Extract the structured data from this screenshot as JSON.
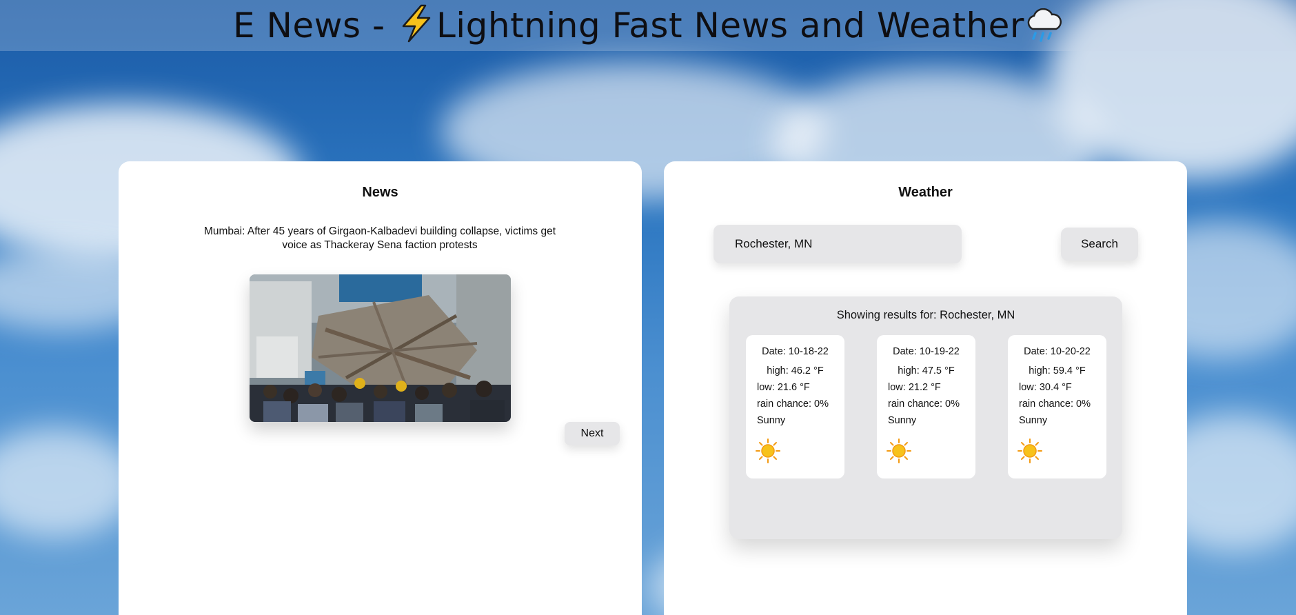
{
  "header": {
    "title_prefix": "E News - ",
    "title_main": "Lightning Fast News and Weather",
    "lightning_icon": "lightning-icon",
    "rain_cloud_icon": "rain-cloud-icon"
  },
  "news": {
    "heading": "News",
    "headline": "Mumbai: After 45 years of Girgaon-Kalbadevi building collapse, victims get voice as Thackeray Sena faction protests",
    "next_label": "Next"
  },
  "weather": {
    "heading": "Weather",
    "search_value": "Rochester, MN",
    "search_label": "Search",
    "results_heading": "Showing results for: Rochester, MN",
    "days": [
      {
        "date": "Date: 10-18-22",
        "high": "high: 46.2 °F",
        "low": "low: 21.6 °F",
        "rain": "rain chance: 0%",
        "condition": "Sunny",
        "icon": "sun-icon"
      },
      {
        "date": "Date: 10-19-22",
        "high": "high: 47.5 °F",
        "low": "low: 21.2 °F",
        "rain": "rain chance: 0%",
        "condition": "Sunny",
        "icon": "sun-icon"
      },
      {
        "date": "Date: 10-20-22",
        "high": "high: 59.4 °F",
        "low": "low: 30.4 °F",
        "rain": "rain chance: 0%",
        "condition": "Sunny",
        "icon": "sun-icon"
      }
    ]
  },
  "colors": {
    "panel_bg": "#ffffff",
    "control_bg": "#e6e6e8",
    "sun_yellow": "#f7c21b",
    "sun_orange": "#f39a12"
  }
}
